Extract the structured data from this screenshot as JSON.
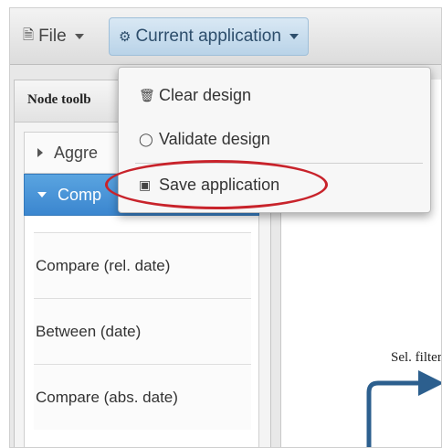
{
  "toolbar": {
    "file_label": "File",
    "app_label": "Current application"
  },
  "menu": {
    "items": [
      {
        "label": "Clear design",
        "icon": "trash-icon"
      },
      {
        "label": "Validate design",
        "icon": "lightbulb-icon"
      },
      {
        "label": "Save application",
        "icon": "floppy-disk-icon"
      }
    ]
  },
  "sidebar": {
    "title": "Node toolb",
    "sections": [
      {
        "label": "Aggre",
        "expanded": false
      },
      {
        "label": "Comp",
        "expanded": true
      }
    ],
    "nodes": [
      {
        "label": "Compare (rel. date)"
      },
      {
        "label": "Between (date)"
      },
      {
        "label": "Compare (abs. date)"
      }
    ]
  },
  "canvas": {
    "node_label": "Sel. filter"
  },
  "colors": {
    "accent": "#3b86cf",
    "highlight": "#c8232b",
    "flow": "#2c5f8e"
  }
}
